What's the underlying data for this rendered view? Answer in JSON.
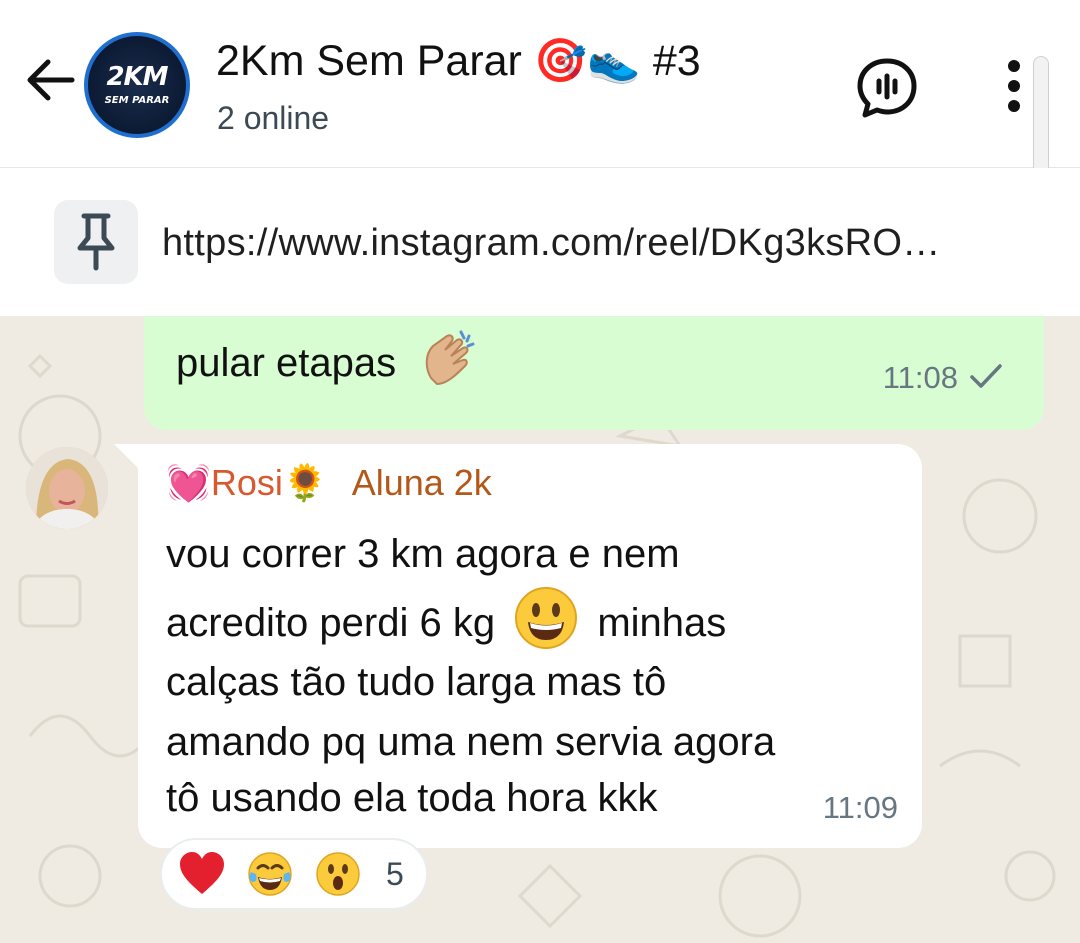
{
  "header": {
    "title": "2Km Sem Parar",
    "title_emoji": "🎯👟",
    "title_suffix": "#3",
    "subtitle": "2 online",
    "logo_line1": "2KM",
    "logo_line2": "SEM PARAR",
    "icons": [
      "back-arrow-icon",
      "voice-chat-icon",
      "more-options-icon"
    ]
  },
  "pinned": {
    "icon": "pin-icon",
    "text": "https://www.instagram.com/reel/DKg3ksRO…"
  },
  "messages": [
    {
      "direction": "outgoing",
      "text": "pular etapas",
      "emoji": "clapping-hands",
      "time": "11:08",
      "status": "sent-check"
    },
    {
      "direction": "incoming",
      "sender": "💓Rosi🌻",
      "sender_role": "Aluna 2k",
      "lines": [
        "vou correr 3 km agora e nem",
        "acredito perdi 6 kg",
        "minhas",
        "calças tão tudo larga mas tô",
        "amando pq uma nem servia agora",
        "tô usando ela toda hora kkk"
      ],
      "inline_emoji": "grinning-face",
      "time": "11:09",
      "reactions": [
        "heart",
        "tears-of-joy",
        "astonished"
      ],
      "reaction_count": "5"
    }
  ],
  "colors": {
    "outgoing_bubble": "#d9fdd3",
    "incoming_bubble": "#ffffff",
    "chat_bg": "#efeae2",
    "sender_name": "#d8582f",
    "timestamp": "#667781"
  }
}
